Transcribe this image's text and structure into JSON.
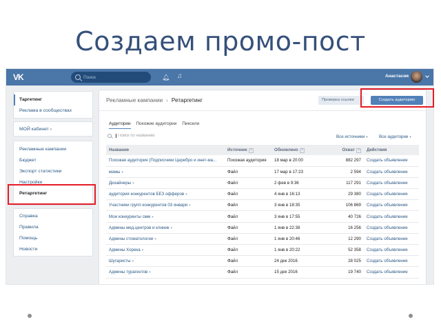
{
  "slide": {
    "title": "Создаем промо-пост"
  },
  "topbar": {
    "logo": "VK",
    "search_placeholder": "Поиск",
    "user_name": "Анастасия"
  },
  "sidebar": {
    "group1": [
      "Таргетинг",
      "Реклама в сообществах"
    ],
    "cabinet": "МОЙ кабинет",
    "group3": [
      "Рекламные кампании",
      "Бюджет",
      "Экспорт статистики",
      "Настройки",
      "Ретаргетинг"
    ],
    "group4": [
      "Справка",
      "Правила",
      "Помощь",
      "Новости"
    ]
  },
  "main": {
    "breadcrumb": {
      "parent": "Рекламные кампании",
      "separator": "›",
      "current": "Ретаргетинг"
    },
    "check_button": "Проверка ссылки",
    "create_button": "Создать аудиторию",
    "tabs": [
      "Аудитории",
      "Похожие аудитории",
      "Пиксели"
    ],
    "filter_placeholder": "Поиск по названию",
    "source_filter": "Все источники",
    "audience_filter": "Все аудитории",
    "table": {
      "headers": [
        "Название",
        "Источник",
        "Обновлено",
        "Охват",
        "Действия"
      ],
      "help_mark": "?",
      "rows": [
        {
          "name": "Похожая аудитория (Подписчики Церебро и инет-ма...",
          "source": "Похожая аудитория",
          "updated": "18 мар в 20:00",
          "reach": "882 297",
          "action": "Создать объявление"
        },
        {
          "name": "мамы",
          "source": "Файл",
          "updated": "17 мар в 17:23",
          "reach": "2 594",
          "action": "Создать объявление"
        },
        {
          "name": "Дизайнеры",
          "source": "Файл",
          "updated": "2 фев в 9:36",
          "reach": "117 291",
          "action": "Создать объявление"
        },
        {
          "name": "аудитория конкурентов БЕЗ офферов",
          "source": "Файл",
          "updated": "4 янв в 16:13",
          "reach": "29 380",
          "action": "Создать объявление"
        },
        {
          "name": "Участники групп конкурентов 03 января",
          "source": "Файл",
          "updated": "3 янв в 18:35",
          "reach": "106 869",
          "action": "Создать объявление"
        },
        {
          "name": "Мои конкуренты смм",
          "source": "Файл",
          "updated": "3 янв в 17:55",
          "reach": "40 726",
          "action": "Создать объявление"
        },
        {
          "name": "Админы мед.центров и клиник",
          "source": "Файл",
          "updated": "1 янв в 22:38",
          "reach": "16 256",
          "action": "Создать объявление"
        },
        {
          "name": "Админы стоматологии",
          "source": "Файл",
          "updated": "1 янв в 20:46",
          "reach": "12 290",
          "action": "Создать объявление"
        },
        {
          "name": "Админы Хорека",
          "source": "Файл",
          "updated": "1 янв в 20:22",
          "reach": "52 358",
          "action": "Создать объявление"
        },
        {
          "name": "Шугаристы",
          "source": "Файл",
          "updated": "24 дек 2016",
          "reach": "28 025",
          "action": "Создать объявление"
        },
        {
          "name": "Админы турагентов",
          "source": "Файл",
          "updated": "15 дек 2016",
          "reach": "19 740",
          "action": "Создать объявление"
        }
      ]
    }
  },
  "accent_colors": {
    "vk_blue": "#4a76a8",
    "button_blue": "#5181b8",
    "highlight_red": "#e41b25",
    "title_blue": "#35507a"
  }
}
